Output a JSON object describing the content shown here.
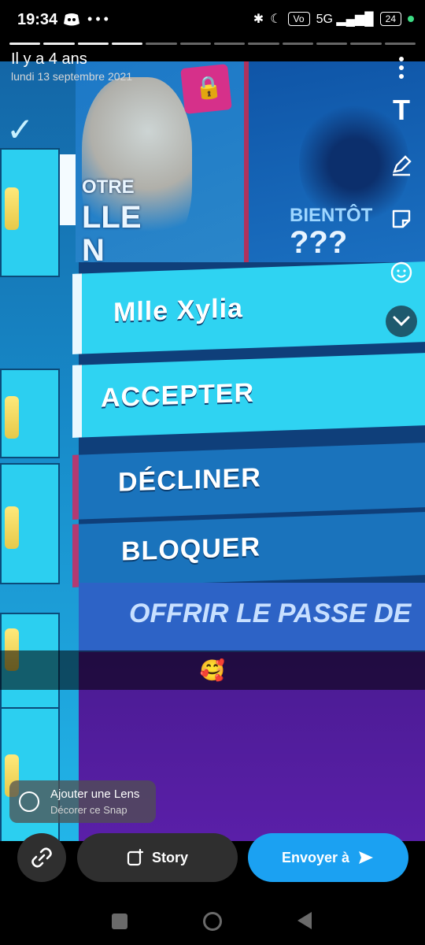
{
  "status_bar": {
    "time": "19:34",
    "left_icons": [
      "discord-icon",
      "more-dots-icon"
    ],
    "right_icons": [
      "bluetooth-icon",
      "do-not-disturb-icon",
      "volte-icon",
      "5g-signal-icon"
    ],
    "battery": "24"
  },
  "header": {
    "title": "Il y a 4 ans",
    "date": "lundi 13 septembre 2021"
  },
  "photo": {
    "card_left_text": [
      "OTRE",
      "LLE",
      "N"
    ],
    "card_right_soon": "BIENTÔT",
    "card_right_qmarks": "???",
    "menu": {
      "name": "Mlle Xylia",
      "accept": "ACCEPTER",
      "decline": "DÉCLINER",
      "block": "BLOQUER",
      "gift": "OFFRIR LE PASSE DE"
    }
  },
  "caption": "🥰",
  "tools": [
    "more-icon",
    "text-tool-icon",
    "pen-tool-icon",
    "sticker-icon",
    "lens-face-icon",
    "chevron-down-icon"
  ],
  "lens_chip": {
    "title": "Ajouter une Lens",
    "subtitle": "Décorer ce Snap"
  },
  "actions": {
    "story_label": "Story",
    "send_label": "Envoyer à"
  },
  "colors": {
    "send_button": "#1ba1f2",
    "caption_bar": "#000000",
    "action_pill": "#2f2f2f"
  }
}
